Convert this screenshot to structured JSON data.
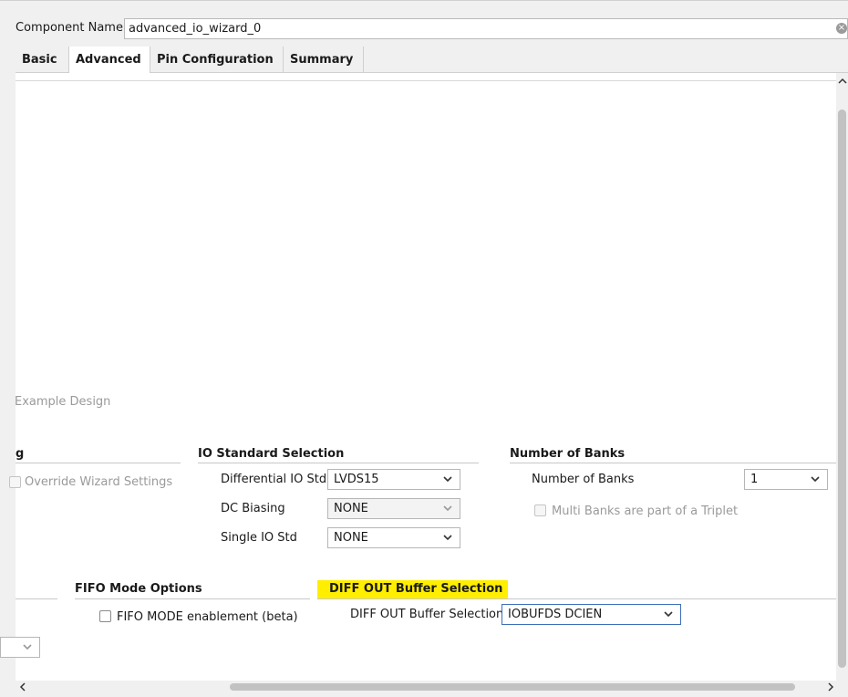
{
  "header": {
    "component_label": "Component Name",
    "component_value": "advanced_io_wizard_0"
  },
  "tabs": [
    {
      "label": "Basic"
    },
    {
      "label": "Advanced"
    },
    {
      "label": "Pin Configuration"
    },
    {
      "label": "Summary"
    }
  ],
  "active_tab": "Advanced",
  "example": {
    "label": "Example Design"
  },
  "left_section": {
    "title_fragment": "g",
    "override_label": "Override Wizard Settings"
  },
  "io_standard": {
    "title": "IO Standard Selection",
    "differential_label": "Differential IO Std",
    "differential_value": "LVDS15",
    "dc_biasing_label": "DC Biasing",
    "dc_biasing_value": "NONE",
    "single_label": "Single IO Std",
    "single_value": "NONE"
  },
  "banks": {
    "title": "Number of Banks",
    "count_label": "Number of Banks",
    "count_value": "1",
    "triplet_label": "Multi Banks are part of a Triplet"
  },
  "fifo": {
    "title": "FIFO Mode Options",
    "enable_label": "FIFO MODE enablement (beta)"
  },
  "diff_out": {
    "title": "DIFF OUT Buffer Selection",
    "field_label": "DIFF OUT Buffer Selection",
    "field_value": "IOBUFDS DCIEN"
  },
  "colors": {
    "highlight": "#ffee00",
    "focus_border": "#3d6fb8",
    "disabled_text": "#9a9a9a"
  }
}
